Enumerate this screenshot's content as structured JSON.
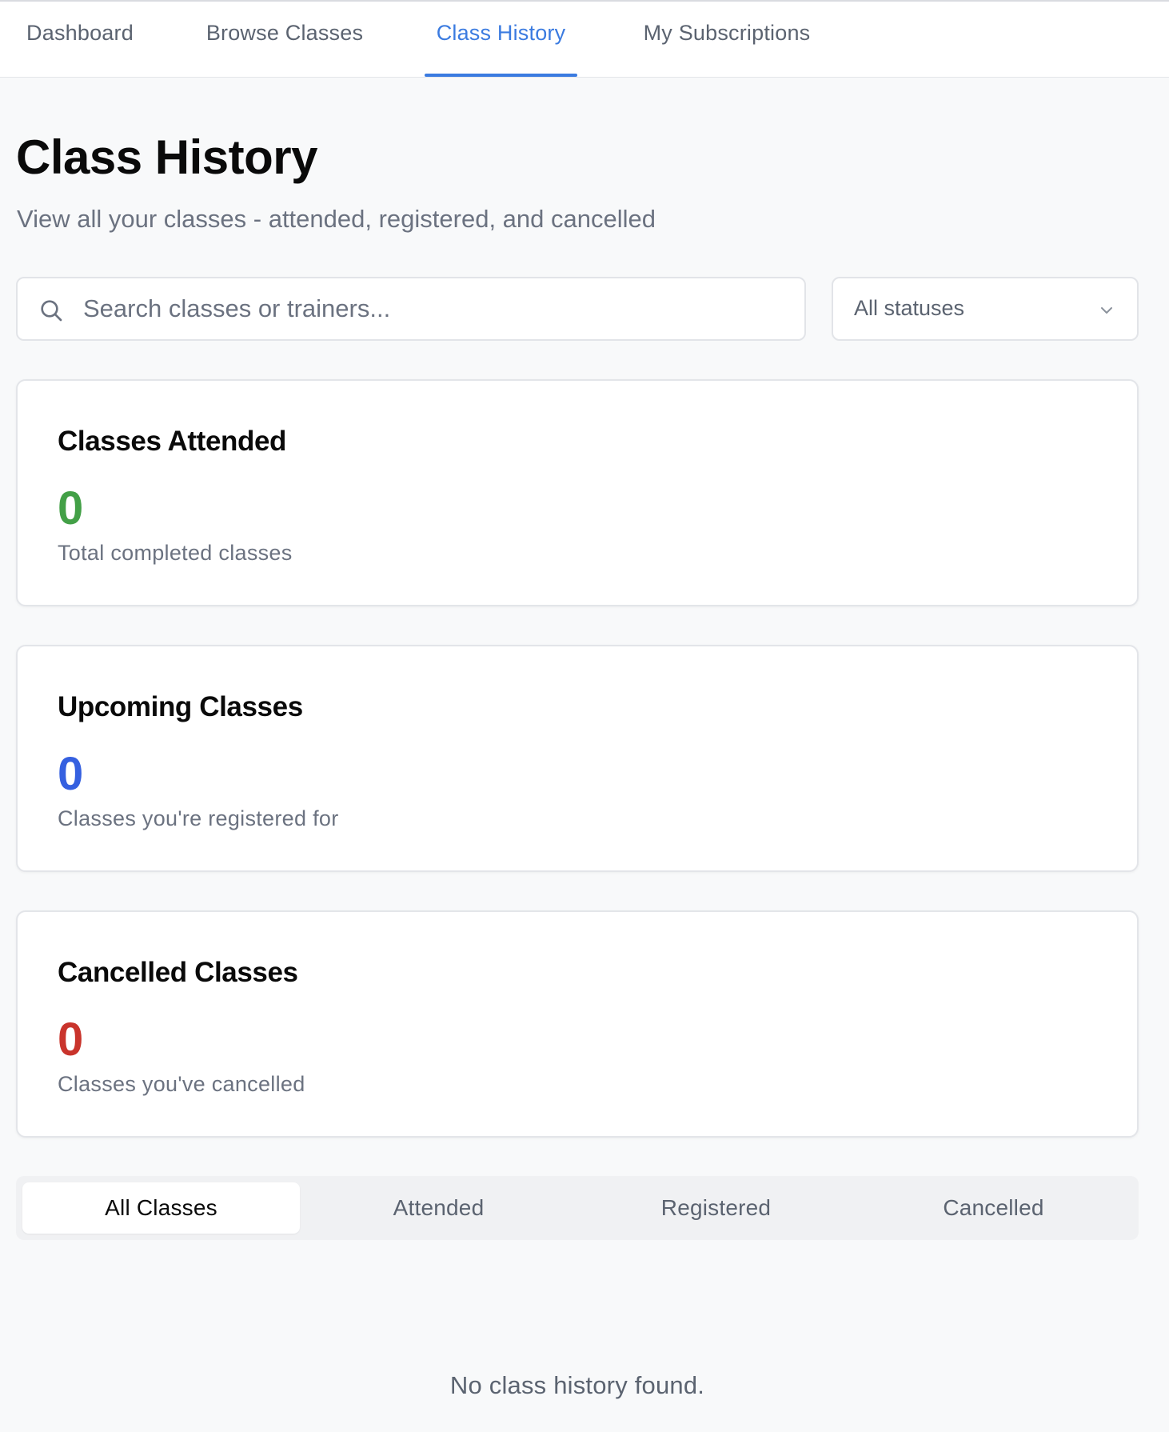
{
  "nav": {
    "tabs": [
      {
        "label": "Dashboard",
        "active": false
      },
      {
        "label": "Browse Classes",
        "active": false
      },
      {
        "label": "Class History",
        "active": true
      },
      {
        "label": "My Subscriptions",
        "active": false
      }
    ]
  },
  "header": {
    "title": "Class History",
    "subtitle": "View all your classes - attended, registered, and cancelled"
  },
  "search": {
    "placeholder": "Search classes or trainers...",
    "value": "",
    "icon": "search-icon"
  },
  "status_filter": {
    "selected": "All statuses",
    "icon": "chevron-down-icon"
  },
  "stats": [
    {
      "title": "Classes Attended",
      "value": "0",
      "description": "Total completed classes",
      "color": "#43a047"
    },
    {
      "title": "Upcoming Classes",
      "value": "0",
      "description": "Classes you're registered for",
      "color": "#3560e0"
    },
    {
      "title": "Cancelled Classes",
      "value": "0",
      "description": "Classes you've cancelled",
      "color": "#c9342c"
    }
  ],
  "filter_tabs": [
    {
      "label": "All Classes",
      "active": true
    },
    {
      "label": "Attended",
      "active": false
    },
    {
      "label": "Registered",
      "active": false
    },
    {
      "label": "Cancelled",
      "active": false
    }
  ],
  "empty_state": {
    "message": "No class history found."
  },
  "colors": {
    "accent": "#3b7be0",
    "background": "#f8f9fa",
    "muted_text": "#6b7280"
  }
}
